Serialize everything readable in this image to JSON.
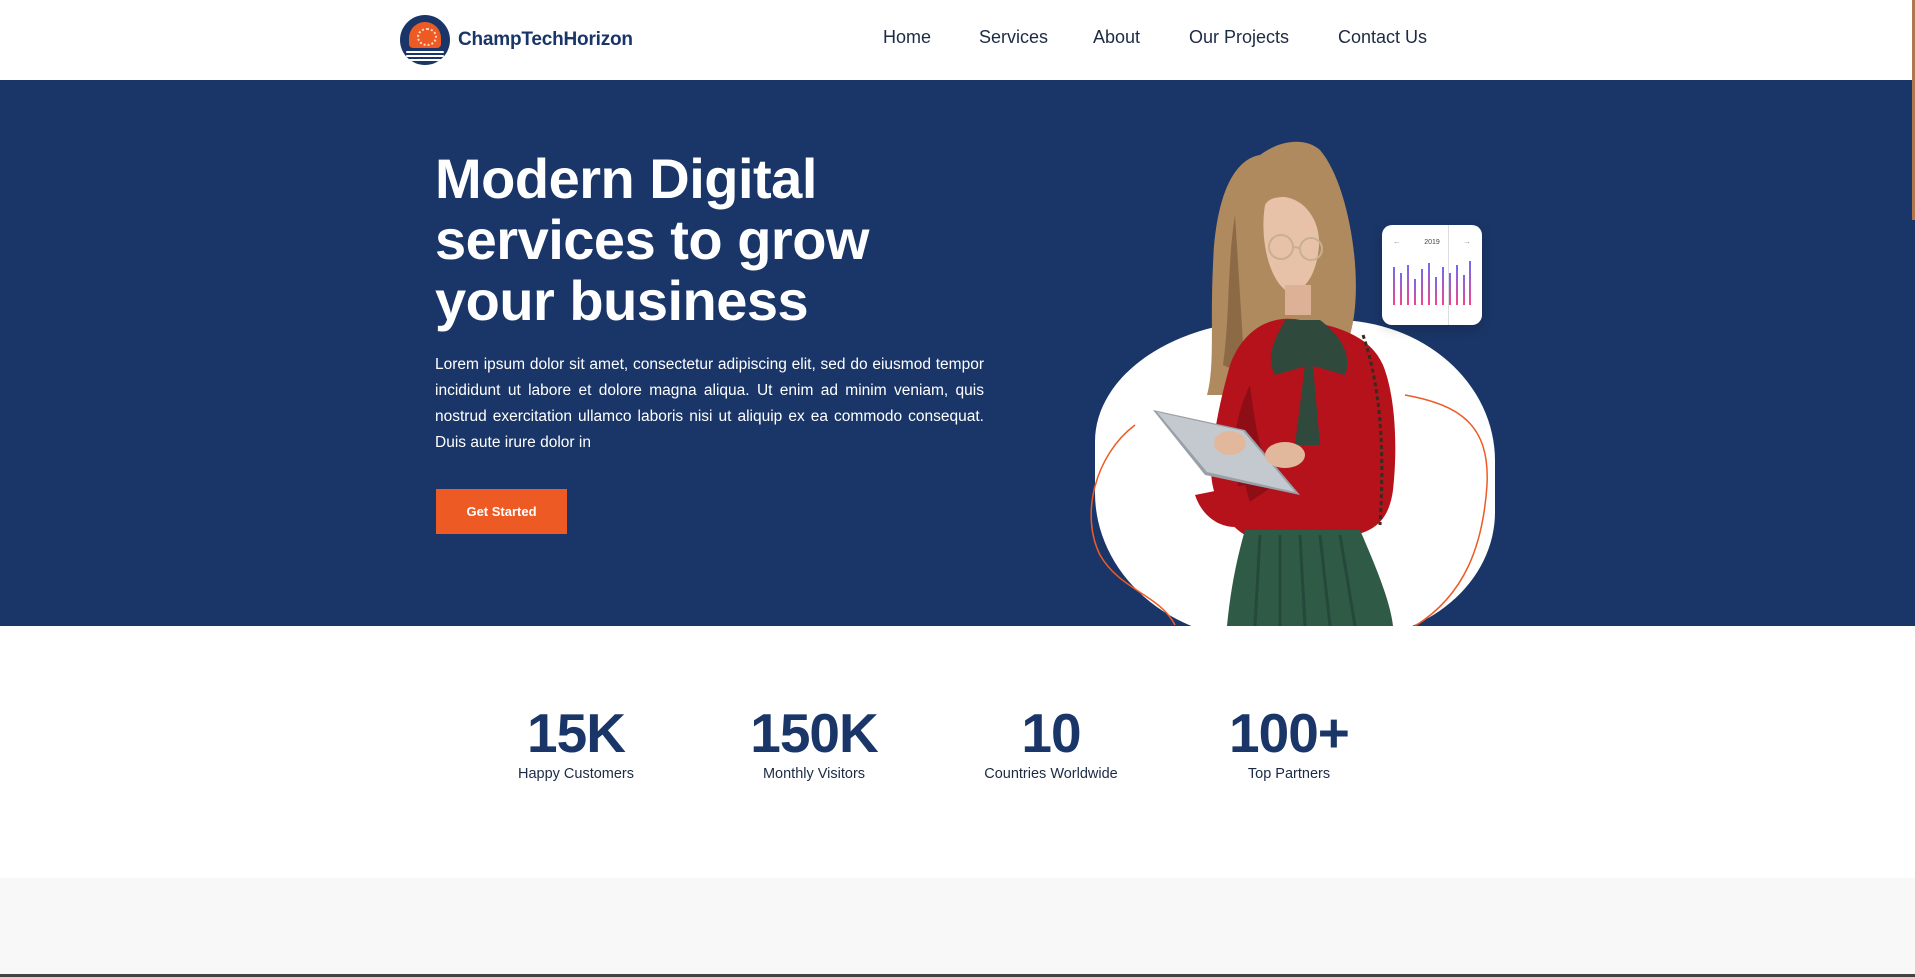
{
  "brand": {
    "name": "ChampTechHorizon"
  },
  "nav": {
    "items": [
      {
        "label": "Home"
      },
      {
        "label": "Services"
      },
      {
        "label": "About"
      },
      {
        "label": "Our Projects"
      },
      {
        "label": "Contact Us"
      }
    ]
  },
  "hero": {
    "title": "Modern Digital services to grow your business",
    "description": "Lorem ipsum dolor sit amet, consectetur adipiscing elit, sed do eiusmod tempor incididunt ut labore et dolore magna aliqua. Ut enim ad minim veniam, quis nostrud exercitation ullamco laboris nisi ut aliquip ex ea commodo consequat. Duis aute irure dolor in",
    "cta_label": "Get Started",
    "card": {
      "year": "2019"
    }
  },
  "stats": [
    {
      "value": "15K",
      "label": "Happy Customers"
    },
    {
      "value": "150K",
      "label": "Monthly Visitors"
    },
    {
      "value": "10",
      "label": "Countries Worldwide"
    },
    {
      "value": "100+",
      "label": "Top Partners"
    }
  ],
  "colors": {
    "primary": "#1a3668",
    "accent": "#ee5a24",
    "text": "#1c2a44",
    "background": "#ffffff",
    "section_alt": "#f7f8f7"
  }
}
